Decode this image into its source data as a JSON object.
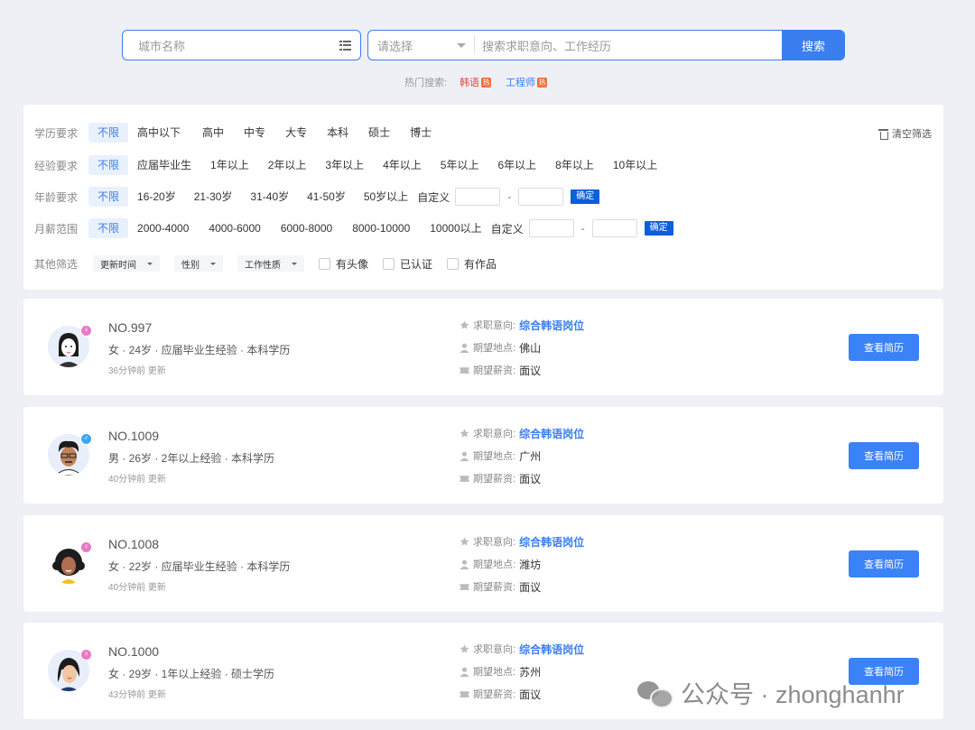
{
  "search": {
    "city_placeholder": "城市名称",
    "select_placeholder": "请选择",
    "keyword_placeholder": "搜索求职意向、工作经历",
    "button_label": "搜索"
  },
  "hot": {
    "label": "热门搜索:",
    "badge": "热",
    "tags": [
      {
        "label": "韩语",
        "color": "#e8453c"
      },
      {
        "label": "工程师",
        "color": "#3b7ef0"
      }
    ]
  },
  "filters": {
    "clear_label": "清空筛选",
    "custom_label": "自定义",
    "confirm_label": "确定",
    "range_sep": "-",
    "education": {
      "label": "学历要求",
      "options": [
        "不限",
        "高中以下",
        "高中",
        "中专",
        "大专",
        "本科",
        "硕士",
        "博士"
      ]
    },
    "experience": {
      "label": "经验要求",
      "options": [
        "不限",
        "应届毕业生",
        "1年以上",
        "2年以上",
        "3年以上",
        "4年以上",
        "5年以上",
        "6年以上",
        "8年以上",
        "10年以上"
      ]
    },
    "age": {
      "label": "年龄要求",
      "options": [
        "不限",
        "16-20岁",
        "21-30岁",
        "31-40岁",
        "41-50岁",
        "50岁以上"
      ]
    },
    "salary": {
      "label": "月薪范围",
      "options": [
        "不限",
        "2000-4000",
        "4000-6000",
        "6000-8000",
        "8000-10000",
        "10000以上"
      ]
    },
    "other": {
      "label": "其他筛选",
      "dropdowns": [
        "更新时间",
        "性别",
        "工作性质"
      ],
      "checkboxes": [
        "有头像",
        "已认证",
        "有作品"
      ]
    }
  },
  "card_labels": {
    "intention": "求职意向:",
    "location": "期望地点:",
    "salary": "期望薪资:",
    "view_button": "查看简历"
  },
  "candidates": [
    {
      "no": "NO.997",
      "meta": "女 · 24岁 · 应届毕业生经验 · 本科学历",
      "updated": "36分钟前 更新",
      "intention": "综合韩语岗位",
      "location": "佛山",
      "salary": "面议",
      "gender": "female",
      "gender_color": "#e879c6"
    },
    {
      "no": "NO.1009",
      "meta": "男 · 26岁 · 2年以上经验 · 本科学历",
      "updated": "40分钟前 更新",
      "intention": "综合韩语岗位",
      "location": "广州",
      "salary": "面议",
      "gender": "male",
      "gender_color": "#3ba7f0"
    },
    {
      "no": "NO.1008",
      "meta": "女 · 22岁 · 应届毕业生经验 · 本科学历",
      "updated": "40分钟前 更新",
      "intention": "综合韩语岗位",
      "location": "潍坊",
      "salary": "面议",
      "gender": "female",
      "gender_color": "#e879c6"
    },
    {
      "no": "NO.1000",
      "meta": "女 · 29岁 · 1年以上经验 · 硕士学历",
      "updated": "43分钟前 更新",
      "intention": "综合韩语岗位",
      "location": "苏州",
      "salary": "面议",
      "gender": "female",
      "gender_color": "#e879c6"
    }
  ],
  "watermark": "公众号 · zhonghanhr"
}
